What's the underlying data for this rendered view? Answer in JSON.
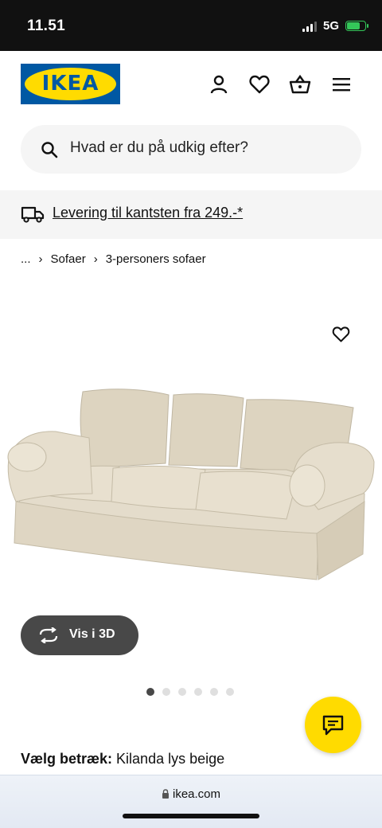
{
  "status_bar": {
    "time": "11.51",
    "network": "5G"
  },
  "header": {
    "logo_text": "IKEA",
    "icons": [
      "account-icon",
      "favorites-heart-icon",
      "basket-icon",
      "menu-icon"
    ]
  },
  "search": {
    "placeholder": "Hvad er du på udkig efter?"
  },
  "delivery": {
    "text": "Levering til kantsten fra 249.-*"
  },
  "breadcrumb": {
    "ellipsis": "...",
    "items": [
      "Sofaer",
      "3-personers sofaer"
    ]
  },
  "product_image": {
    "button_3d": "Vis i 3D",
    "dots_total": 6,
    "active_dot": 0
  },
  "cover": {
    "label": "Vælg betræk:",
    "value": "Kilanda lys beige"
  },
  "browser": {
    "url": "ikea.com"
  },
  "colors": {
    "ikea_blue": "#0058a3",
    "ikea_yellow": "#ffdb00",
    "dark_button": "#484848"
  }
}
